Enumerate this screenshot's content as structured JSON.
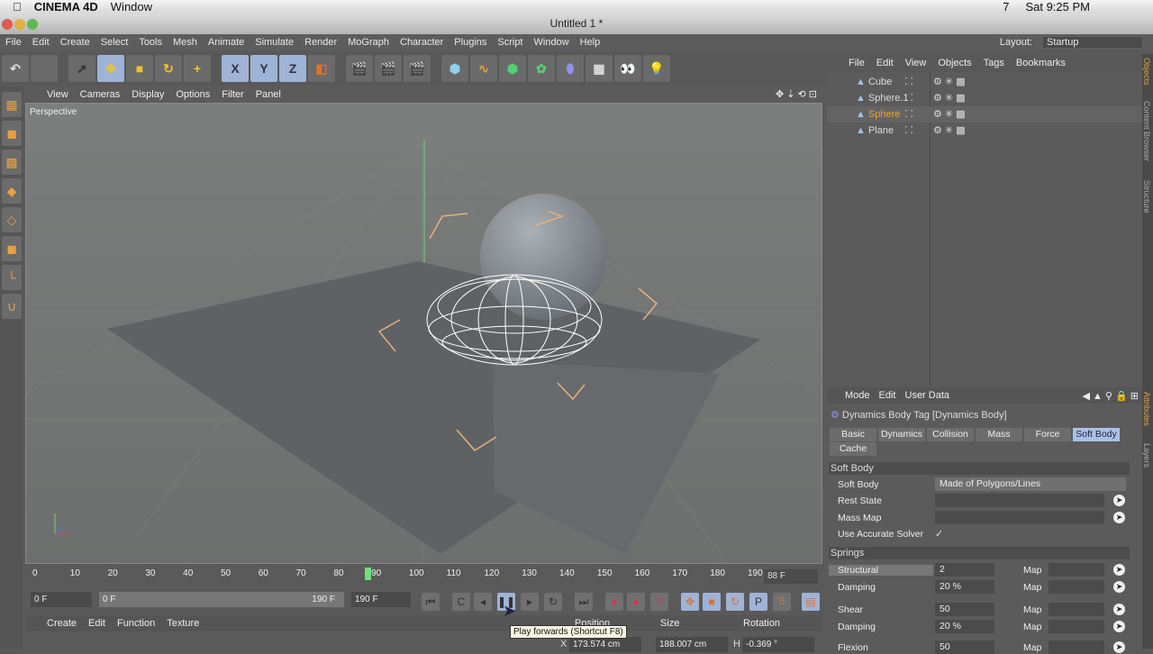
{
  "mac": {
    "app": "CINEMA 4D",
    "menu": "Window",
    "status": [
      "7"
    ],
    "clock": "Sat 9:25 PM"
  },
  "window": {
    "title": "Untitled 1 *",
    "layout_label": "Layout:",
    "layout_value": "Startup"
  },
  "menus": [
    "File",
    "Edit",
    "Create",
    "Select",
    "Tools",
    "Mesh",
    "Animate",
    "Simulate",
    "Render",
    "MoGraph",
    "Character",
    "Plugins",
    "Script",
    "Window",
    "Help"
  ],
  "toolbar": {
    "axis_x": "X",
    "axis_y": "Y",
    "axis_z": "Z"
  },
  "viewport": {
    "menu": [
      "View",
      "Cameras",
      "Display",
      "Options",
      "Filter",
      "Panel"
    ],
    "label": "Perspective"
  },
  "timeline": {
    "ticks": [
      "0",
      "10",
      "20",
      "30",
      "40",
      "50",
      "60",
      "70",
      "80",
      "90",
      "100",
      "110",
      "120",
      "130",
      "140",
      "150",
      "160",
      "170",
      "180",
      "190"
    ],
    "current_frame": "88 F",
    "current": 88,
    "max": 190
  },
  "controls": {
    "start": "0 F",
    "range_start": "0 F",
    "range_end": "190 F",
    "end": "190 F"
  },
  "material_menu": [
    "Create",
    "Edit",
    "Function",
    "Texture"
  ],
  "coords": {
    "headers": [
      "Position",
      "Size",
      "Rotation"
    ],
    "x_label": "X",
    "pos_x": "173.574 cm",
    "size_x": "188.007 cm",
    "h_label": "H",
    "rot_h": "-0.369 °"
  },
  "tooltip": "Play forwards (Shortcut F8)",
  "object_manager": {
    "menu": [
      "File",
      "Edit",
      "View",
      "Objects",
      "Tags",
      "Bookmarks"
    ],
    "objects": [
      {
        "name": "Cube"
      },
      {
        "name": "Sphere.1"
      },
      {
        "name": "Sphere",
        "selected": true
      },
      {
        "name": "Plane"
      }
    ]
  },
  "right_tabs": [
    "Objects",
    "Content Browser",
    "Structure",
    "Attributes",
    "Layers"
  ],
  "attributes": {
    "menu": [
      "Mode",
      "Edit",
      "User Data"
    ],
    "title": "Dynamics Body Tag [Dynamics Body]",
    "tabs": [
      "Basic",
      "Dynamics",
      "Collision",
      "Mass",
      "Force",
      "Soft Body",
      "Cache"
    ],
    "active_tab": "Soft Body",
    "section_soft": "Soft Body",
    "soft_body_label": "Soft Body",
    "soft_body_value": "Made of Polygons/Lines",
    "rest_state": "Rest State",
    "mass_map": "Mass Map",
    "accurate": "Use Accurate Solver",
    "accurate_check": "✓",
    "section_springs": "Springs",
    "map_label": "Map",
    "springs": [
      {
        "label": "Structural",
        "value": "2"
      },
      {
        "label": "Damping",
        "value": "20 %"
      },
      {
        "label": "Shear",
        "value": "50"
      },
      {
        "label": "Damping",
        "value": "20 %"
      },
      {
        "label": "Flexion",
        "value": "50"
      }
    ]
  },
  "colors": {
    "accent": "#a9c1e6",
    "selected_object": "#f0a030",
    "playhead": "#6ee07a"
  }
}
